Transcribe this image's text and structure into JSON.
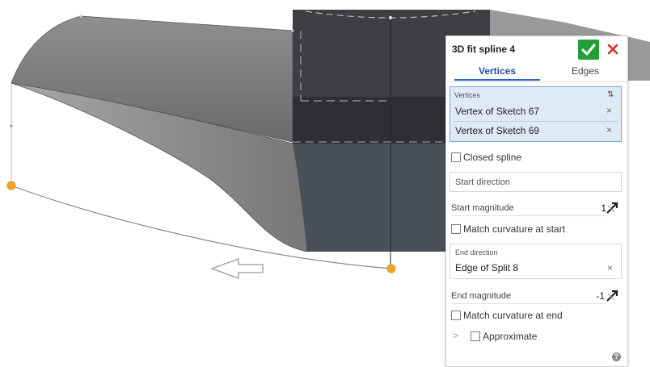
{
  "viewport": {
    "description_icons": [
      "direction-arrow-icon"
    ],
    "accent_color": "#f5a623"
  },
  "feature_panel": {
    "title": "3D fit spline 4",
    "accept_icon": "checkmark-icon",
    "cancel_icon": "close-icon",
    "tabs": [
      {
        "label": "Vertices",
        "active": true
      },
      {
        "label": "Edges",
        "active": false
      }
    ],
    "vertices": {
      "label": "Vertices",
      "sort_icon": "⇅",
      "items": [
        {
          "label": "Vertex of Sketch 67",
          "remove": "×"
        },
        {
          "label": "Vertex of Sketch 69",
          "remove": "×"
        }
      ]
    },
    "closed_spline": {
      "label": "Closed spline",
      "checked": false
    },
    "start_direction": {
      "placeholder": "Start direction"
    },
    "start_magnitude": {
      "label": "Start magnitude",
      "value": "1"
    },
    "match_curvature_start": {
      "label": "Match curvature at start",
      "checked": false
    },
    "end_direction": {
      "label": "End direction",
      "value": "Edge of Split 8",
      "remove": "×"
    },
    "end_magnitude": {
      "label": "End magnitude",
      "value": "-1"
    },
    "match_curvature_end": {
      "label": "Match curvature at end",
      "checked": false
    },
    "approximate": {
      "label": "Approximate",
      "checked": false,
      "expand_icon": ">"
    },
    "help_icon": "?"
  },
  "colors": {
    "accept": "#21a038",
    "cancel": "#d9302c",
    "active_tab": "#1d4ea8",
    "selection_bg": "#dfeaf7",
    "point": "#f5a623"
  }
}
